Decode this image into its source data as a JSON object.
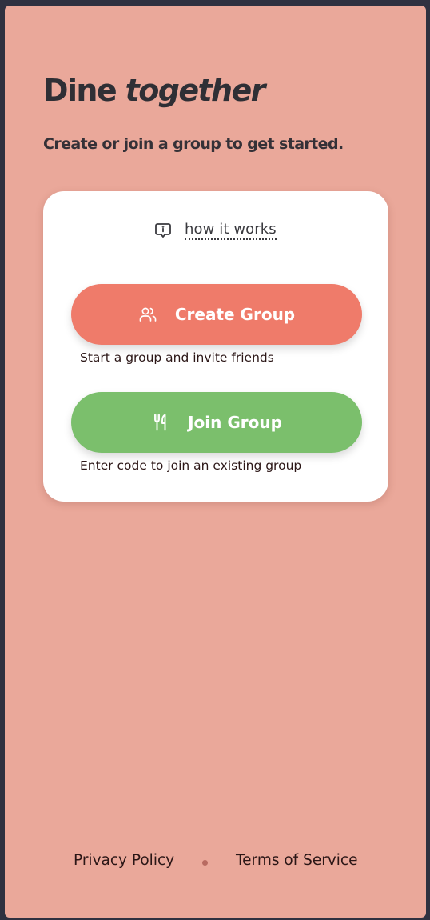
{
  "hero": {
    "title_prefix": "Dine",
    "title_emphasis": "together",
    "subtitle": "Create or join a group to get started."
  },
  "card": {
    "how_it_works": {
      "label": "how it works",
      "icon": "info-speech-bubble-icon"
    },
    "create": {
      "label": "Create Group",
      "icon": "users-icon",
      "helper": "Start a group and invite friends",
      "color": "#ef7b6a"
    },
    "join": {
      "label": "Join Group",
      "icon": "fork-knife-icon",
      "helper": "Enter code to join an existing group",
      "color": "#7bbf6c"
    }
  },
  "footer": {
    "privacy": "Privacy Policy",
    "terms": "Terms of Service"
  },
  "colors": {
    "background": "#eaa89a",
    "outer": "#2f3140",
    "card": "#ffffff",
    "text_dark": "#2f2f35"
  }
}
